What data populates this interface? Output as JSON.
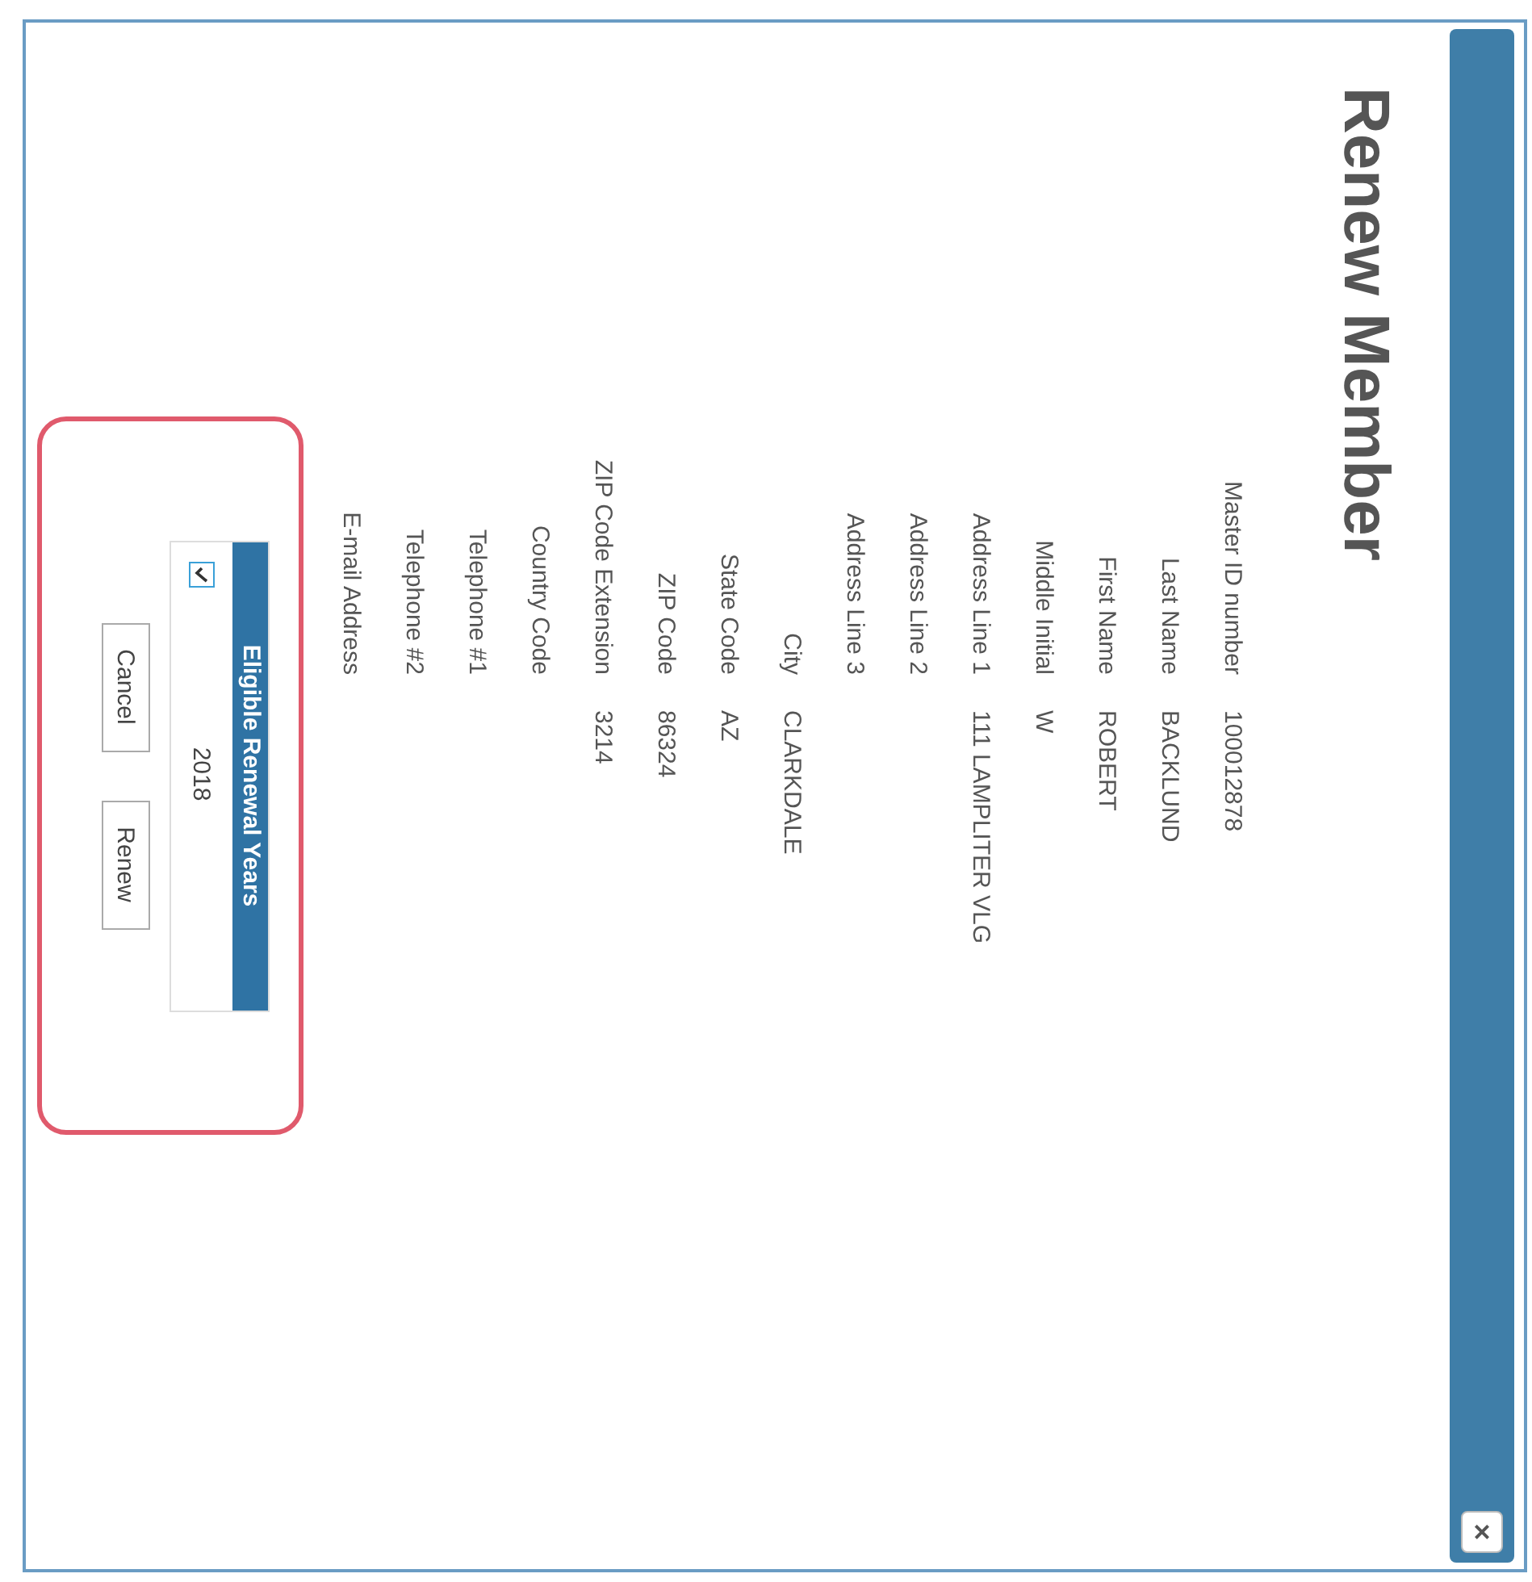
{
  "dialog": {
    "title": "Renew Member",
    "close": "×"
  },
  "fields": [
    {
      "label": "Master ID number",
      "value": "100012878"
    },
    {
      "label": "Last Name",
      "value": "BACKLUND"
    },
    {
      "label": "First Name",
      "value": "ROBERT"
    },
    {
      "label": "Middle Initial",
      "value": "W"
    },
    {
      "label": "Address Line 1",
      "value": "111 LAMPLITER VLG"
    },
    {
      "label": "Address Line 2"
    },
    {
      "label": "Address Line 3"
    },
    {
      "label": "City",
      "value": "CLARKDALE"
    },
    {
      "label": "State Code",
      "value": "AZ"
    },
    {
      "label": "ZIP Code",
      "value": "86324"
    },
    {
      "label": "ZIP Code Extension",
      "value": "3214"
    },
    {
      "label": "Country Code"
    },
    {
      "label": "Telephone #1"
    },
    {
      "label": "Telephone #2"
    },
    {
      "label": "E-mail Address"
    }
  ],
  "renewal": {
    "title": "Eligible Renewal Years",
    "rows": [
      {
        "year": "2018",
        "checked": true
      }
    ]
  },
  "buttons": [
    "Cancel",
    "Renew"
  ]
}
